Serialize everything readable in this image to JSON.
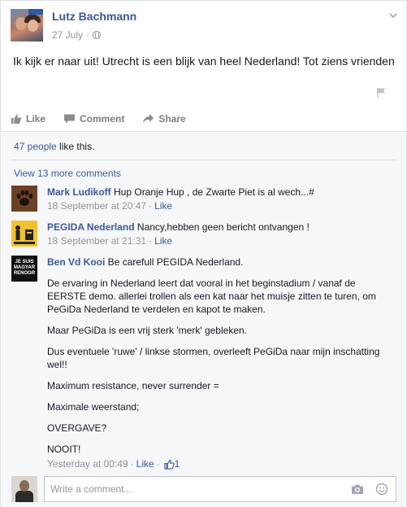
{
  "post": {
    "author": "Lutz Bachmann",
    "date": "27 July",
    "dot": "·",
    "text": "Ik kijk er naar uit! Utrecht is een blijk van heel Nederland! Tot ziens vrienden"
  },
  "actions": {
    "like": "Like",
    "comment": "Comment",
    "share": "Share"
  },
  "likes": {
    "count_link": "47 people",
    "suffix": " like this."
  },
  "view_more": "View 13 more comments",
  "comments": [
    {
      "name": "Mark Ludikoff",
      "text": " Hup Oranje Hup , de Zwarte Piet is al wech...#",
      "time": "18 September at 20:47",
      "like": "Like"
    },
    {
      "name": "PEGIDA Nederland",
      "text": " Nancy,hebben geen bericht ontvangen !",
      "time": "18 September at 21:31",
      "like": "Like"
    },
    {
      "name": "Ben Vd Kooi",
      "text": " Be carefull PEGIDA Nederland.",
      "paragraphs": [
        "De ervaring in Nederland leert dat vooral in het beginstadium / vanaf de EERSTE demo. allerlei trollen als een kat naar het muisje zitten te turen, om PeGiDa Nederland te verdelen en kapot te maken.",
        "Maar PeGiDa is een vrij sterk 'merk' gebleken.",
        "Dus eventuele 'ruwe' / linkse stormen, overleeft PeGiDa naar mijn inschatting wel!!",
        "Maximum resistance, never surrender =",
        "Maximale weerstand;",
        "OVERGAVE?",
        "NOOIT!"
      ],
      "time": "Yesterday at 00:49",
      "like": "Like",
      "like_count": "1",
      "avatar_text": "JE SUIS MAGYAR RENOOR"
    }
  ],
  "composer": {
    "placeholder": "Write a comment..."
  },
  "colors": {
    "link": "#3b5998",
    "meta": "#90949c",
    "feedback_bg": "#f6f7f9"
  },
  "icons": [
    "chevron-down-icon",
    "globe-icon",
    "flag-icon",
    "thumbs-up-icon",
    "comment-icon",
    "share-icon",
    "camera-icon",
    "emoji-icon"
  ]
}
